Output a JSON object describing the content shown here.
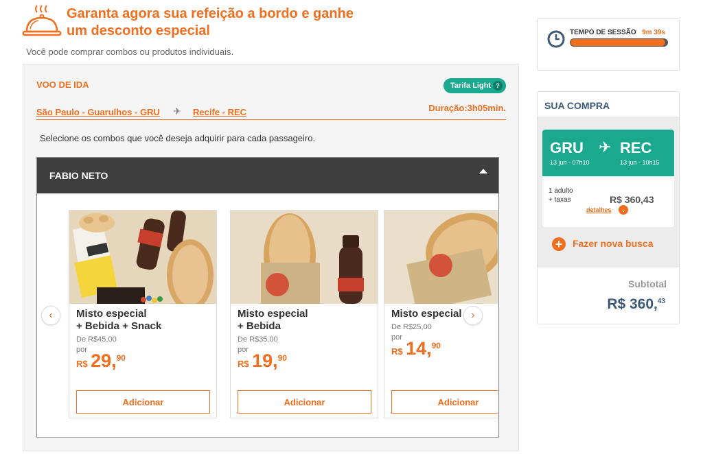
{
  "header": {
    "title": "Garanta agora sua refeição a bordo e ganhe um desconto especial",
    "subtitle": "Você pode comprar combos ou produtos individuais.",
    "icon": "food-cloche-icon"
  },
  "flight": {
    "label": "VOO DE IDA",
    "tarifa": "Tarifa Light",
    "tarifa_help": "?",
    "from": "São Paulo - Guarulhos - GRU",
    "to": "Recife - REC",
    "duration": "Duração:3h05min.",
    "instruction": "Selecione os combos que você deseja adquirir para cada passageiro."
  },
  "passenger": {
    "name": "FABIO NETO",
    "products": [
      {
        "name_line1": "Misto especial",
        "name_line2": "+ Bebida + Snack",
        "old_price": "De R$45,00",
        "por": "por",
        "currency": "R$",
        "price_int": "29,",
        "price_dec": "90",
        "button": "Adicionar"
      },
      {
        "name_line1": "Misto especial",
        "name_line2": "+ Bebida",
        "old_price": "De R$35,00",
        "por": "por",
        "currency": "R$",
        "price_int": "19,",
        "price_dec": "90",
        "button": "Adicionar"
      },
      {
        "name_line1": "Misto especial",
        "name_line2": "",
        "old_price": "De R$25,00",
        "por": "por",
        "currency": "R$",
        "price_int": "14,",
        "price_dec": "90",
        "button": "Adicionar"
      }
    ],
    "prev_icon": "‹",
    "next_icon": "›"
  },
  "session": {
    "label": "TEMPO DE SESSÃO",
    "time": "9m 39s",
    "progress": 0.98,
    "icon": "clock-icon"
  },
  "purchase": {
    "title": "SUA COMPRA",
    "from": "GRU",
    "to": "REC",
    "dep": "13 jun - 07h10",
    "arr": "13 jun - 10h15",
    "pax_line1": "1 adulto",
    "pax_line2": "+ taxas",
    "price": "R$ 360,43",
    "details": "detalhes",
    "new_search": "Fazer nova busca",
    "subtotal_label": "Subtotal",
    "subtotal_main": "R$ 360,",
    "subtotal_cents": "43"
  },
  "colors": {
    "accent": "#f06e1e",
    "teal": "#1aa88e",
    "dark_header": "#3e3e3e",
    "navy_text": "#3c5a78"
  }
}
